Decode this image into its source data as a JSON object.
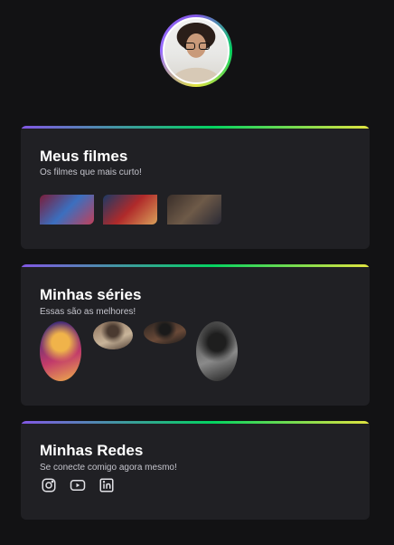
{
  "profile": {
    "avatar_alt": "Profile photo"
  },
  "sections": {
    "movies": {
      "title": "Meus filmes",
      "subtitle": "Os filmes que mais curto!",
      "items": [
        {
          "icon": "movie-poster-1",
          "colors": [
            "#7a1d3a",
            "#3b6fbf",
            "#c0405a"
          ]
        },
        {
          "icon": "movie-poster-2",
          "colors": [
            "#1b3a66",
            "#b02a2a",
            "#d9a05a"
          ]
        },
        {
          "icon": "movie-poster-3",
          "colors": [
            "#3a2f2a",
            "#6e5a48",
            "#2a2a35"
          ]
        }
      ]
    },
    "series": {
      "title": "Minhas séries",
      "subtitle": "Essas são as melhores!",
      "items": [
        {
          "icon": "series-poster-1",
          "colors": [
            "#2a2a7a",
            "#c23b6a",
            "#f0b34a"
          ]
        },
        {
          "icon": "series-poster-2",
          "colors": [
            "#8a6f5a",
            "#c9b59a",
            "#4a3a30"
          ]
        },
        {
          "icon": "series-poster-3",
          "colors": [
            "#2a2320",
            "#6a4a38",
            "#1a1a1a"
          ]
        },
        {
          "icon": "series-poster-4",
          "colors": [
            "#3a3a3a",
            "#8a8a8a",
            "#1e1e1e"
          ]
        }
      ]
    },
    "social": {
      "title": "Minhas Redes",
      "subtitle": "Se conecte comigo agora mesmo!",
      "items": [
        {
          "icon": "instagram-icon"
        },
        {
          "icon": "youtube-icon"
        },
        {
          "icon": "linkedin-icon"
        }
      ]
    }
  }
}
